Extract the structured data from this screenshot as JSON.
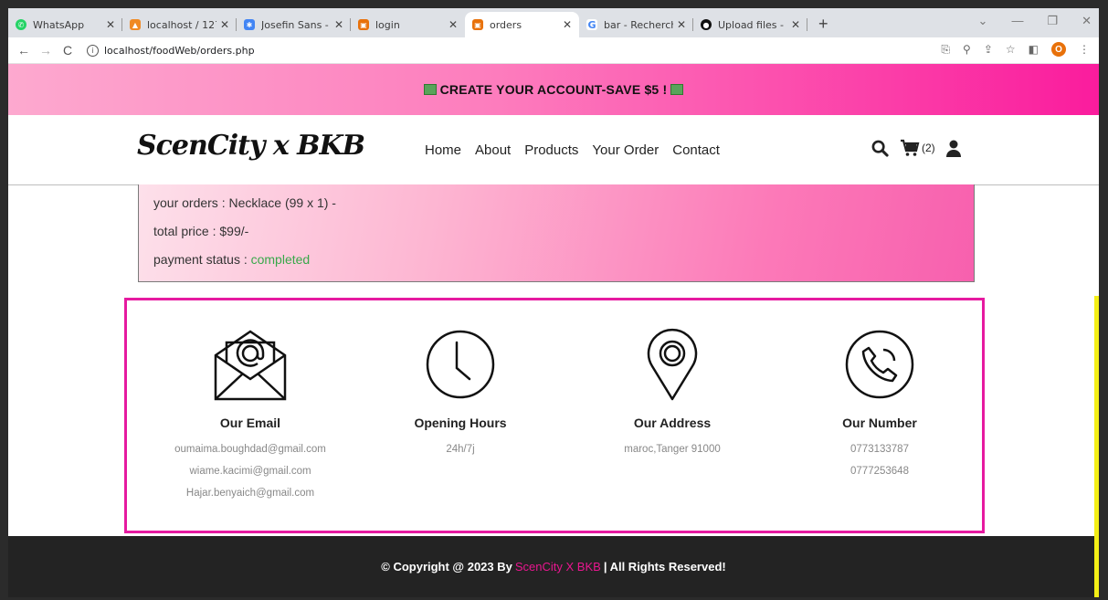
{
  "browser": {
    "tabs": [
      {
        "title": "WhatsApp",
        "color": "#25d366",
        "glyph": "✆"
      },
      {
        "title": "localhost / 127.0.",
        "color": "#f08a24",
        "glyph": "▲"
      },
      {
        "title": "Josefin Sans - Go",
        "color": "#4285f4",
        "glyph": "✱"
      },
      {
        "title": "login",
        "color": "#e8710a",
        "glyph": "▣"
      },
      {
        "title": "orders",
        "color": "#e8710a",
        "glyph": "▣",
        "active": true
      },
      {
        "title": "bar - Recherche",
        "color": "#4285f4",
        "glyph": "G"
      },
      {
        "title": "Upload files - Ou",
        "color": "#111111",
        "glyph": "●"
      }
    ],
    "url": "localhost/foodWeb/orders.php",
    "profile_initial": "O"
  },
  "promo": {
    "text": "CREATE YOUR ACCOUNT-SAVE $5 !"
  },
  "header": {
    "logo": "ScenCity x BKB",
    "nav": [
      "Home",
      "About",
      "Products",
      "Your Order",
      "Contact"
    ],
    "cart_count": "(2)"
  },
  "order": {
    "orders_line": "your orders : Necklace (99 x 1) -",
    "total_line": "total price : $99/-",
    "payment_label": "payment status : ",
    "payment_value": "completed"
  },
  "contact": {
    "email": {
      "heading": "Our Email",
      "values": [
        "oumaima.boughdad@gmail.com",
        "wiame.kacimi@gmail.com",
        "Hajar.benyaich@gmail.com"
      ]
    },
    "hours": {
      "heading": "Opening Hours",
      "values": [
        "24h/7j"
      ]
    },
    "address": {
      "heading": "Our Address",
      "values": [
        "maroc,Tanger 91000"
      ]
    },
    "number": {
      "heading": "Our Number",
      "values": [
        "0773133787",
        "0777253648"
      ]
    }
  },
  "footer": {
    "prefix": "© Copyright @ 2023 By",
    "brand": "ScenCity X BKB",
    "suffix": "| All Rights Reserved!"
  },
  "colors": {
    "accent": "#e61aa0",
    "status_green": "#38a84a",
    "footer_bg": "#232323"
  }
}
